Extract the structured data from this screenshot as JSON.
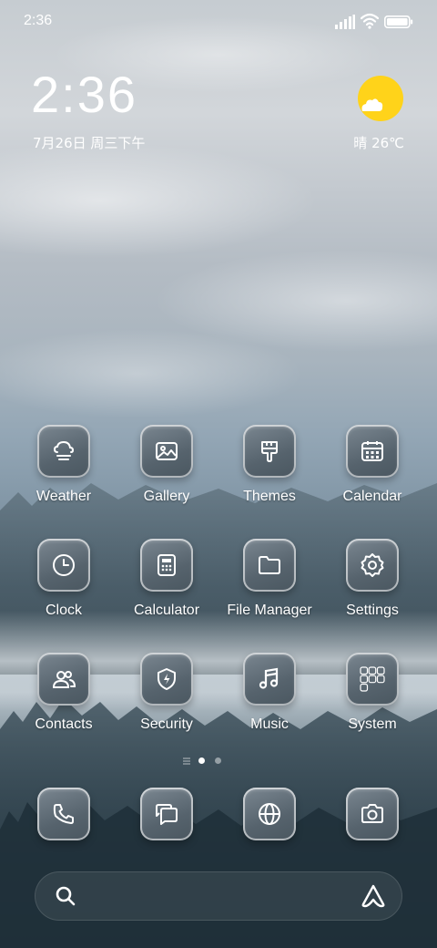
{
  "status_bar": {
    "time": "2:36",
    "icons": [
      "signal-icon",
      "wifi-icon",
      "battery-icon"
    ]
  },
  "clock_widget": {
    "time": "2:36",
    "date": "7月26日 周三下午"
  },
  "weather_widget": {
    "icon": "sun-cloud-icon",
    "text": "晴 26℃",
    "sun_color": "#ffd31a"
  },
  "apps": [
    {
      "label": "Weather",
      "icon": "weather-icon"
    },
    {
      "label": "Gallery",
      "icon": "gallery-icon"
    },
    {
      "label": "Themes",
      "icon": "themes-icon"
    },
    {
      "label": "Calendar",
      "icon": "calendar-icon"
    },
    {
      "label": "Clock",
      "icon": "clock-icon"
    },
    {
      "label": "Calculator",
      "icon": "calculator-icon"
    },
    {
      "label": "File Manager",
      "icon": "folder-icon"
    },
    {
      "label": "Settings",
      "icon": "gear-icon"
    },
    {
      "label": "Contacts",
      "icon": "contacts-icon"
    },
    {
      "label": "Security",
      "icon": "shield-icon"
    },
    {
      "label": "Music",
      "icon": "music-icon"
    },
    {
      "label": "System",
      "icon": "folder-grid-icon"
    }
  ],
  "page_indicator": {
    "pages": 2,
    "current": 1
  },
  "dock": [
    {
      "icon": "phone-icon"
    },
    {
      "icon": "messages-icon"
    },
    {
      "icon": "browser-icon"
    },
    {
      "icon": "camera-icon"
    }
  ],
  "search_bar": {
    "icon": "search-icon",
    "assistant_icon": "assistant-icon"
  }
}
